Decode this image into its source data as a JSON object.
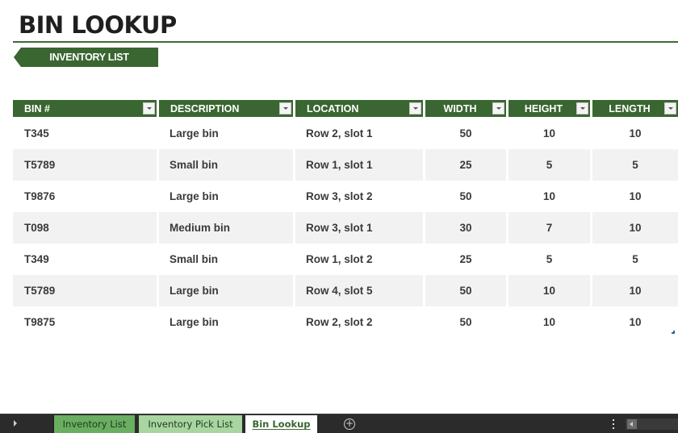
{
  "header": {
    "title": "BIN LOOKUP",
    "nav_button_label": "INVENTORY LIST"
  },
  "table": {
    "columns": [
      "BIN #",
      "DESCRIPTION",
      "LOCATION",
      "WIDTH",
      "HEIGHT",
      "LENGTH"
    ],
    "rows": [
      [
        "T345",
        "Large bin",
        "Row 2, slot 1",
        "50",
        "10",
        "10"
      ],
      [
        "T5789",
        "Small bin",
        "Row 1, slot 1",
        "25",
        "5",
        "5"
      ],
      [
        "T9876",
        "Large bin",
        "Row 3, slot 2",
        "50",
        "10",
        "10"
      ],
      [
        "T098",
        "Medium bin",
        "Row 3, slot 1",
        "30",
        "7",
        "10"
      ],
      [
        "T349",
        "Small bin",
        "Row 1, slot 2",
        "25",
        "5",
        "5"
      ],
      [
        "T5789",
        "Large bin",
        "Row 4, slot 5",
        "50",
        "10",
        "10"
      ],
      [
        "T9875",
        "Large bin",
        "Row 2, slot 2",
        "50",
        "10",
        "10"
      ]
    ]
  },
  "sheet_tabs": {
    "tabs": [
      "Inventory List",
      "Inventory Pick List",
      "Bin Lookup"
    ],
    "active": "Bin Lookup",
    "add_icon": "plus-circle-icon"
  },
  "colors": {
    "accent": "#3a6631",
    "tab_inventory_list": "#6aae61",
    "tab_pick_list": "#a8d5a0",
    "row_alt": "#f2f2f2"
  }
}
